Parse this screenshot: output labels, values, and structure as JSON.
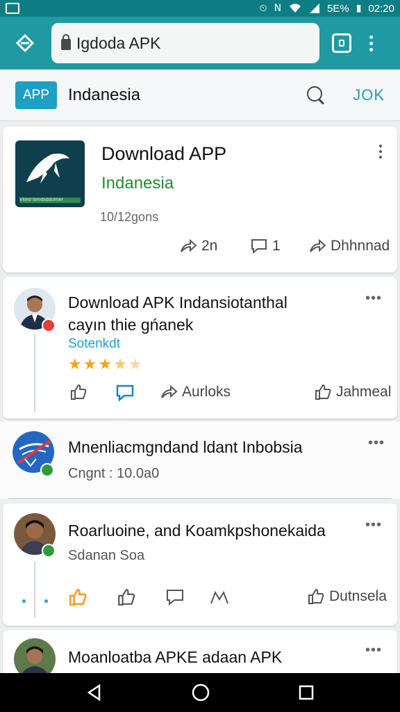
{
  "status_bar": {
    "battery_percent": "5E%",
    "time": "02:20"
  },
  "browser": {
    "url": "Igdoda APK"
  },
  "header": {
    "badge": "APP",
    "title": "Indanesia",
    "action": "JOK"
  },
  "app_card": {
    "title": "Download APP",
    "subtitle": "Indanesia",
    "logo_text": "Vkesl lomdsddulmer",
    "meta": "10/12gons",
    "actions": {
      "share_count": "2n",
      "comment_count": "1",
      "download_label": "Dhhnnad"
    }
  },
  "posts": [
    {
      "title_line1": "Download APK Indansiotanthal",
      "title_line2": "cayın thie gńanek",
      "link": "Sotenkdt",
      "rating": 3.5,
      "actions": {
        "repost_label": "Aurloks",
        "right_label": "Jahmeal"
      }
    },
    {
      "title": "Mnenliacmgndand ldant Inbobsia",
      "meta": "Cngnt : 10.0a0"
    },
    {
      "title": "Roarluoine, and Koamkpshonekaida",
      "meta": "Sdanan Soa",
      "actions": {
        "right_label": "Dutnsela"
      }
    },
    {
      "title": "Moanloatba APKE adaan APK"
    }
  ],
  "colors": {
    "status_bar": "#0f7e84",
    "toolbar": "#1f9aa3",
    "accent": "#1f9fc1",
    "subtitle_green": "#2a8a3a",
    "link_blue": "#22a2c8",
    "star": "#f0a51c"
  }
}
